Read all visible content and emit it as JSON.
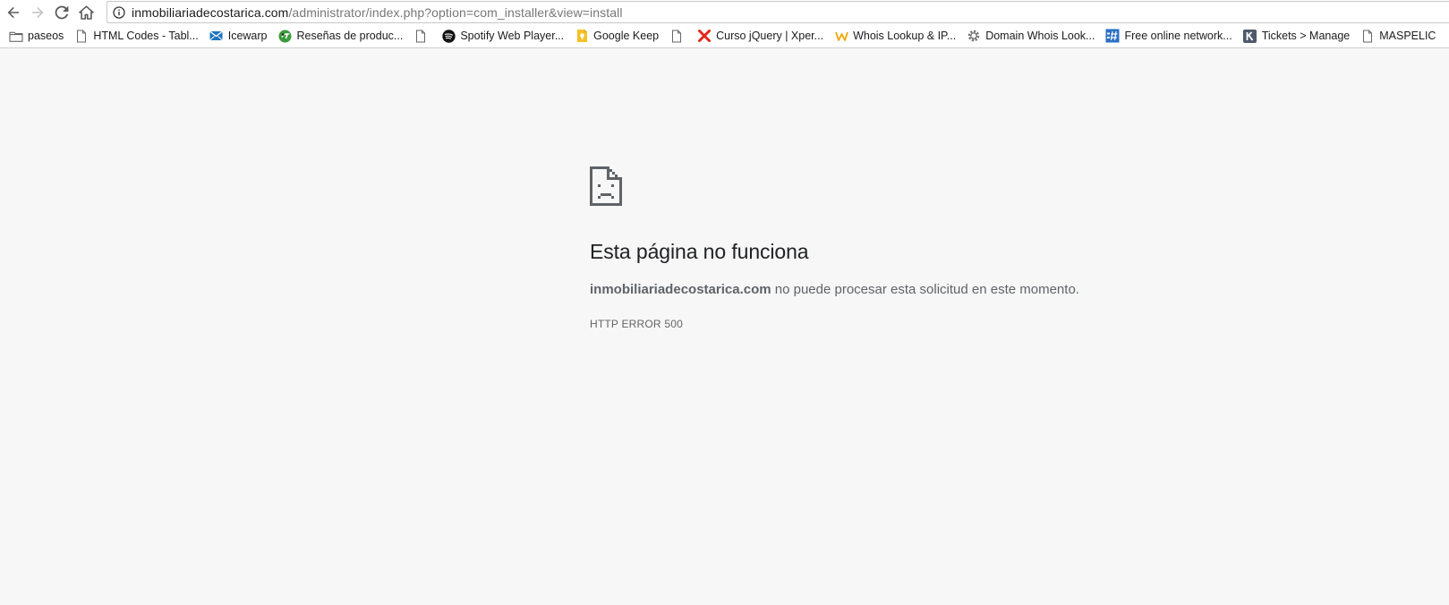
{
  "toolbar": {
    "url_host": "inmobiliariadecostarica.com",
    "url_path": "/administrator/index.php?option=com_installer&view=install"
  },
  "bookmarks": [
    {
      "label": "paseos",
      "icon": "folder-icon"
    },
    {
      "label": "HTML Codes - Tabl...",
      "icon": "page-icon"
    },
    {
      "label": "Icewarp",
      "icon": "mail-icon"
    },
    {
      "label": "Reseñas de produc...",
      "icon": "green-logo-icon"
    },
    {
      "label": "",
      "icon": "page-icon"
    },
    {
      "label": "Spotify Web Player...",
      "icon": "spotify-icon"
    },
    {
      "label": "Google Keep",
      "icon": "keep-icon"
    },
    {
      "label": "",
      "icon": "page-icon"
    },
    {
      "label": "Curso jQuery | Xper...",
      "icon": "x-icon"
    },
    {
      "label": "Whois Lookup & IP...",
      "icon": "w-icon"
    },
    {
      "label": "Domain Whois Look...",
      "icon": "gear-icon"
    },
    {
      "label": "Free online network...",
      "icon": "network-icon"
    },
    {
      "label": "Tickets > Manage",
      "icon": "k-icon"
    },
    {
      "label": "MASPELIC",
      "icon": "page-icon"
    }
  ],
  "error": {
    "title": "Esta página no funciona",
    "domain": "inmobiliariadecostarica.com",
    "message": " no puede procesar esta solicitud en este momento.",
    "code": "HTTP ERROR 500"
  },
  "colors": {
    "page_bg": "#f7f7f7",
    "text_dark": "#202124",
    "text_gray": "#5f6368"
  }
}
